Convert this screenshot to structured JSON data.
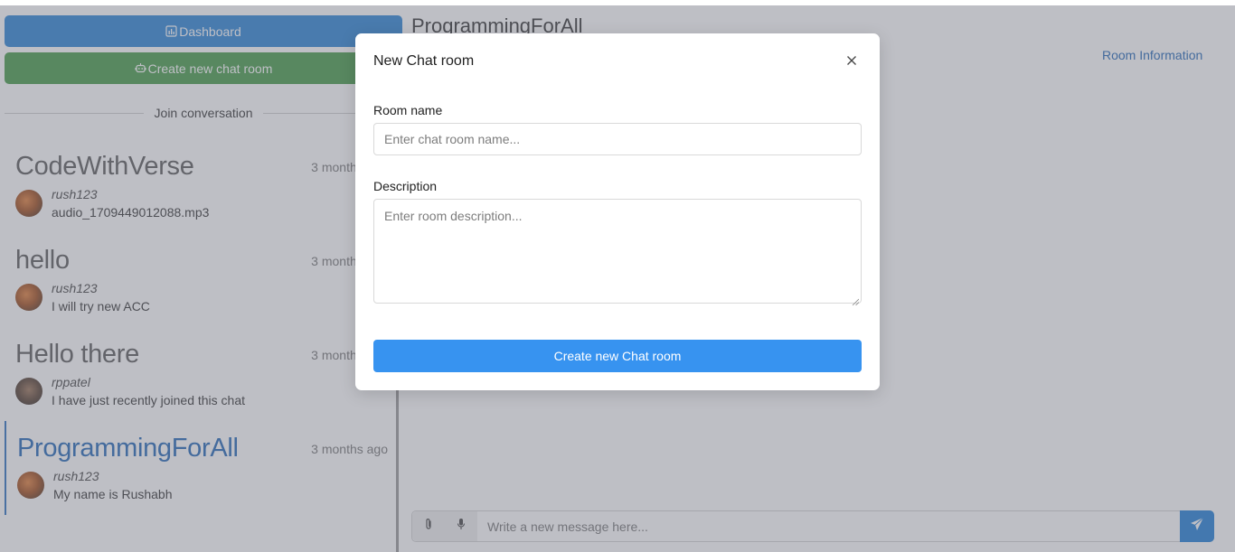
{
  "sidebar": {
    "dashboard_label": "Dashboard",
    "new_room_label": "Create new chat room",
    "join_label": "Join conversation",
    "rooms": [
      {
        "name": "CodeWithVerse",
        "time": "3 months ago",
        "user": "rush123",
        "message": "audio_1709449012088.mp3"
      },
      {
        "name": "hello",
        "time": "3 months ago",
        "user": "rush123",
        "message": "I will try new ACC"
      },
      {
        "name": "Hello there",
        "time": "3 months ago",
        "user": "rppatel",
        "message": "I have just recently joined this chat"
      },
      {
        "name": "ProgrammingForAll",
        "time": "3 months ago",
        "user": "rush123",
        "message": "My name is Rushabh"
      }
    ]
  },
  "main": {
    "title": "ProgrammingForAll",
    "room_info_label": "Room Information",
    "message_placeholder": "Write a new message here..."
  },
  "modal": {
    "title": "New Chat room",
    "room_name_label": "Room name",
    "room_name_placeholder": "Enter chat room name...",
    "description_label": "Description",
    "description_placeholder": "Enter room description...",
    "submit_label": "Create new Chat room"
  },
  "colors": {
    "primary": "#2a83d6",
    "success": "#469c47",
    "link": "#2166b6",
    "modal_button": "#3793f0",
    "overlay": "rgba(110,112,126,0.45)"
  },
  "icons": {
    "dashboard": "chart-icon",
    "new_room": "robot-icon",
    "close": "close-icon",
    "attach": "paperclip-icon",
    "mic": "microphone-icon",
    "send": "send-icon"
  }
}
